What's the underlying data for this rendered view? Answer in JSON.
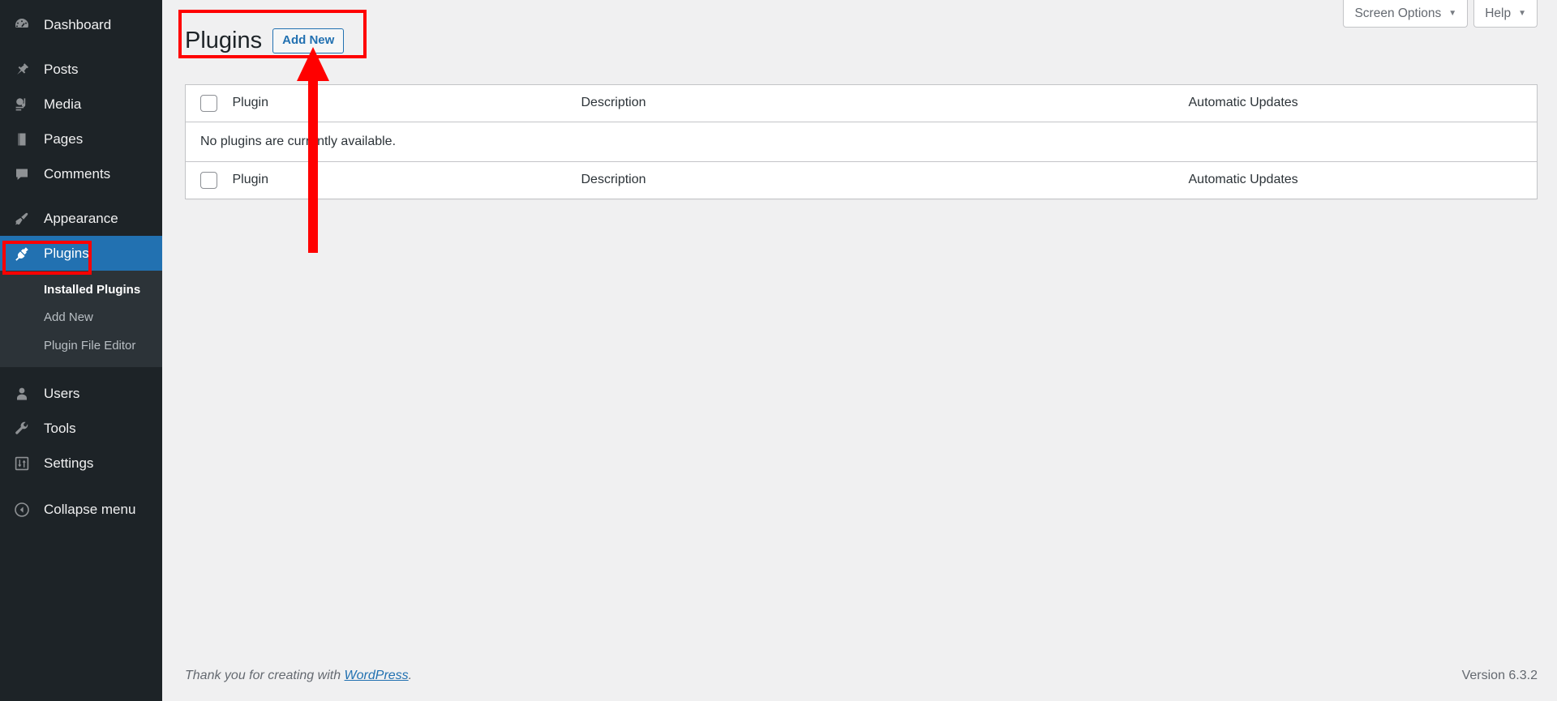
{
  "sidebar": {
    "items": [
      {
        "label": "Dashboard",
        "icon": "dashboard-icon",
        "current": false
      },
      {
        "label": "Posts",
        "icon": "pin-icon",
        "current": false
      },
      {
        "label": "Media",
        "icon": "media-icon",
        "current": false
      },
      {
        "label": "Pages",
        "icon": "pages-icon",
        "current": false
      },
      {
        "label": "Comments",
        "icon": "comments-icon",
        "current": false
      },
      {
        "label": "Appearance",
        "icon": "paintbrush-icon",
        "current": false
      },
      {
        "label": "Plugins",
        "icon": "plug-icon",
        "current": true
      },
      {
        "label": "Users",
        "icon": "user-icon",
        "current": false
      },
      {
        "label": "Tools",
        "icon": "wrench-icon",
        "current": false
      },
      {
        "label": "Settings",
        "icon": "sliders-icon",
        "current": false
      },
      {
        "label": "Collapse menu",
        "icon": "collapse-arrow-icon",
        "current": false
      }
    ],
    "submenu": [
      {
        "label": "Installed Plugins",
        "current": true
      },
      {
        "label": "Add New",
        "current": false
      },
      {
        "label": "Plugin File Editor",
        "current": false
      }
    ]
  },
  "screen_meta": {
    "screen_options_label": "Screen Options",
    "help_label": "Help",
    "caret": "▼"
  },
  "header": {
    "title": "Plugins",
    "add_new_label": "Add New"
  },
  "table": {
    "columns": {
      "plugin": "Plugin",
      "description": "Description",
      "automatic_updates": "Automatic Updates"
    },
    "empty_message": "No plugins are currently available."
  },
  "footer": {
    "thanks_prefix": "Thank you for creating with ",
    "wordpress_link": "WordPress",
    "thanks_suffix": ".",
    "version": "Version 6.3.2"
  },
  "colors": {
    "sidebar_bg": "#1d2327",
    "submenu_bg": "#2c3338",
    "active_blue": "#2271b1",
    "content_bg": "#f0f0f1",
    "annotation_red": "#ff0000",
    "link_blue": "#2271b1"
  }
}
